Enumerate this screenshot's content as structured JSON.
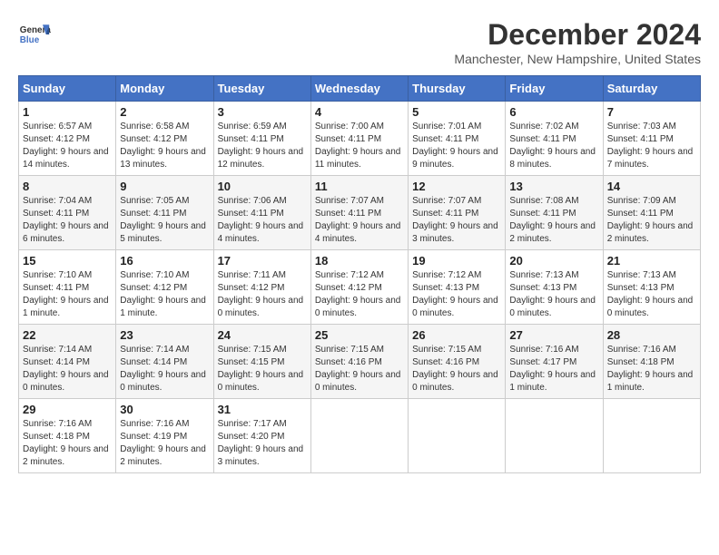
{
  "header": {
    "logo_line1": "General",
    "logo_line2": "Blue",
    "title": "December 2024",
    "subtitle": "Manchester, New Hampshire, United States"
  },
  "weekdays": [
    "Sunday",
    "Monday",
    "Tuesday",
    "Wednesday",
    "Thursday",
    "Friday",
    "Saturday"
  ],
  "weeks": [
    [
      {
        "day": "1",
        "sunrise": "6:57 AM",
        "sunset": "4:12 PM",
        "daylight": "9 hours and 14 minutes."
      },
      {
        "day": "2",
        "sunrise": "6:58 AM",
        "sunset": "4:12 PM",
        "daylight": "9 hours and 13 minutes."
      },
      {
        "day": "3",
        "sunrise": "6:59 AM",
        "sunset": "4:11 PM",
        "daylight": "9 hours and 12 minutes."
      },
      {
        "day": "4",
        "sunrise": "7:00 AM",
        "sunset": "4:11 PM",
        "daylight": "9 hours and 11 minutes."
      },
      {
        "day": "5",
        "sunrise": "7:01 AM",
        "sunset": "4:11 PM",
        "daylight": "9 hours and 9 minutes."
      },
      {
        "day": "6",
        "sunrise": "7:02 AM",
        "sunset": "4:11 PM",
        "daylight": "9 hours and 8 minutes."
      },
      {
        "day": "7",
        "sunrise": "7:03 AM",
        "sunset": "4:11 PM",
        "daylight": "9 hours and 7 minutes."
      }
    ],
    [
      {
        "day": "8",
        "sunrise": "7:04 AM",
        "sunset": "4:11 PM",
        "daylight": "9 hours and 6 minutes."
      },
      {
        "day": "9",
        "sunrise": "7:05 AM",
        "sunset": "4:11 PM",
        "daylight": "9 hours and 5 minutes."
      },
      {
        "day": "10",
        "sunrise": "7:06 AM",
        "sunset": "4:11 PM",
        "daylight": "9 hours and 4 minutes."
      },
      {
        "day": "11",
        "sunrise": "7:07 AM",
        "sunset": "4:11 PM",
        "daylight": "9 hours and 4 minutes."
      },
      {
        "day": "12",
        "sunrise": "7:07 AM",
        "sunset": "4:11 PM",
        "daylight": "9 hours and 3 minutes."
      },
      {
        "day": "13",
        "sunrise": "7:08 AM",
        "sunset": "4:11 PM",
        "daylight": "9 hours and 2 minutes."
      },
      {
        "day": "14",
        "sunrise": "7:09 AM",
        "sunset": "4:11 PM",
        "daylight": "9 hours and 2 minutes."
      }
    ],
    [
      {
        "day": "15",
        "sunrise": "7:10 AM",
        "sunset": "4:11 PM",
        "daylight": "9 hours and 1 minute."
      },
      {
        "day": "16",
        "sunrise": "7:10 AM",
        "sunset": "4:12 PM",
        "daylight": "9 hours and 1 minute."
      },
      {
        "day": "17",
        "sunrise": "7:11 AM",
        "sunset": "4:12 PM",
        "daylight": "9 hours and 0 minutes."
      },
      {
        "day": "18",
        "sunrise": "7:12 AM",
        "sunset": "4:12 PM",
        "daylight": "9 hours and 0 minutes."
      },
      {
        "day": "19",
        "sunrise": "7:12 AM",
        "sunset": "4:13 PM",
        "daylight": "9 hours and 0 minutes."
      },
      {
        "day": "20",
        "sunrise": "7:13 AM",
        "sunset": "4:13 PM",
        "daylight": "9 hours and 0 minutes."
      },
      {
        "day": "21",
        "sunrise": "7:13 AM",
        "sunset": "4:13 PM",
        "daylight": "9 hours and 0 minutes."
      }
    ],
    [
      {
        "day": "22",
        "sunrise": "7:14 AM",
        "sunset": "4:14 PM",
        "daylight": "9 hours and 0 minutes."
      },
      {
        "day": "23",
        "sunrise": "7:14 AM",
        "sunset": "4:14 PM",
        "daylight": "9 hours and 0 minutes."
      },
      {
        "day": "24",
        "sunrise": "7:15 AM",
        "sunset": "4:15 PM",
        "daylight": "9 hours and 0 minutes."
      },
      {
        "day": "25",
        "sunrise": "7:15 AM",
        "sunset": "4:16 PM",
        "daylight": "9 hours and 0 minutes."
      },
      {
        "day": "26",
        "sunrise": "7:15 AM",
        "sunset": "4:16 PM",
        "daylight": "9 hours and 0 minutes."
      },
      {
        "day": "27",
        "sunrise": "7:16 AM",
        "sunset": "4:17 PM",
        "daylight": "9 hours and 1 minute."
      },
      {
        "day": "28",
        "sunrise": "7:16 AM",
        "sunset": "4:18 PM",
        "daylight": "9 hours and 1 minute."
      }
    ],
    [
      {
        "day": "29",
        "sunrise": "7:16 AM",
        "sunset": "4:18 PM",
        "daylight": "9 hours and 2 minutes."
      },
      {
        "day": "30",
        "sunrise": "7:16 AM",
        "sunset": "4:19 PM",
        "daylight": "9 hours and 2 minutes."
      },
      {
        "day": "31",
        "sunrise": "7:17 AM",
        "sunset": "4:20 PM",
        "daylight": "9 hours and 3 minutes."
      },
      null,
      null,
      null,
      null
    ]
  ],
  "labels": {
    "sunrise": "Sunrise:",
    "sunset": "Sunset:",
    "daylight": "Daylight:"
  }
}
